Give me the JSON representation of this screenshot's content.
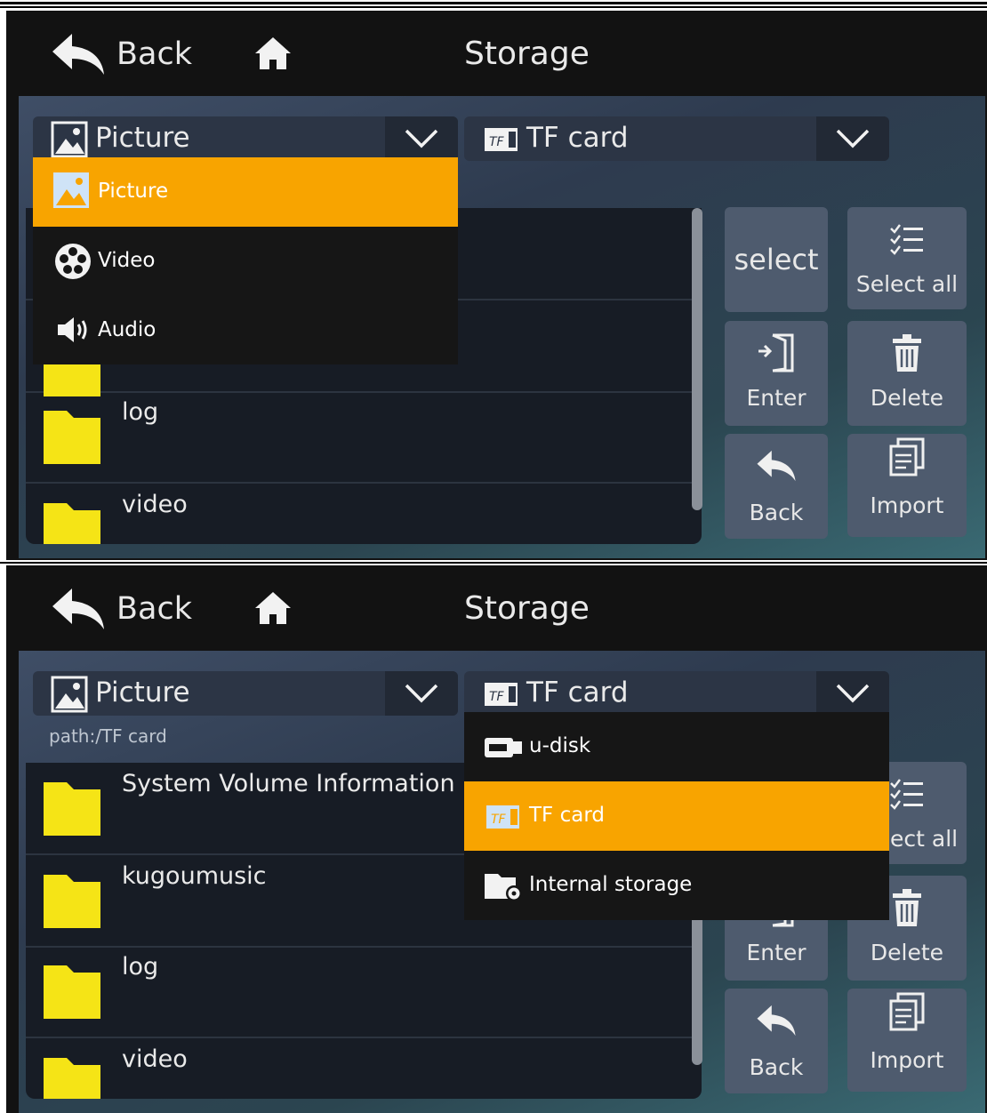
{
  "header": {
    "back_label": "Back",
    "title": "Storage"
  },
  "type_dropdown": {
    "selected": "Picture",
    "options": [
      "Picture",
      "Video",
      "Audio"
    ]
  },
  "storage_dropdown": {
    "selected": "TF card",
    "options": [
      "u-disk",
      "TF card",
      "Internal storage"
    ]
  },
  "path_label": "path:/TF card",
  "file_list": [
    "System Volume Information",
    "kugoumusic",
    "log",
    "video"
  ],
  "buttons": {
    "select": "select",
    "select_all": "Select all",
    "enter": "Enter",
    "delete": "Delete",
    "back": "Back",
    "import": "Import"
  },
  "colors": {
    "highlight": "#f8a400",
    "folder": "#f5e416",
    "background": "#121212"
  }
}
